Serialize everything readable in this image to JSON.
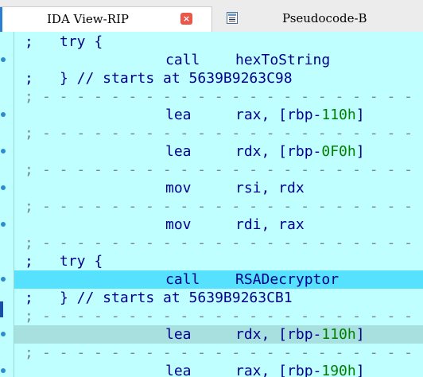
{
  "tabs": [
    {
      "label": "IDA View-RIP",
      "active": true,
      "close_glyph": "×"
    },
    {
      "label": "Pseudocode-B",
      "active": false,
      "icon": "pseudocode-icon"
    }
  ],
  "code": {
    "lines": [
      {
        "kind": "comment",
        "prefix": ";",
        "text": "try {"
      },
      {
        "kind": "instr",
        "mnem": "call",
        "op": "hexToString"
      },
      {
        "kind": "comment",
        "prefix": ";",
        "text": "} // starts at 5639B9263C98"
      },
      {
        "kind": "sep",
        "prefix": ";"
      },
      {
        "kind": "instr",
        "mnem": "lea",
        "op_pre": "rax, [rbp-",
        "num": "110h",
        "op_post": "]"
      },
      {
        "kind": "sep",
        "prefix": ";"
      },
      {
        "kind": "instr",
        "mnem": "lea",
        "op_pre": "rdx, [rbp-",
        "num": "0F0h",
        "op_post": "]"
      },
      {
        "kind": "sep",
        "prefix": ";"
      },
      {
        "kind": "instr",
        "mnem": "mov",
        "op": "rsi, rdx"
      },
      {
        "kind": "sep",
        "prefix": ";"
      },
      {
        "kind": "instr",
        "mnem": "mov",
        "op": "rdi, rax"
      },
      {
        "kind": "sep",
        "prefix": ";"
      },
      {
        "kind": "comment",
        "prefix": ";",
        "text": "try {"
      },
      {
        "kind": "instr",
        "mnem": "call",
        "op": "RSADecryptor",
        "highlight": "current"
      },
      {
        "kind": "comment",
        "prefix": ";",
        "text": "} // starts at 5639B9263CB1"
      },
      {
        "kind": "sep",
        "prefix": ";"
      },
      {
        "kind": "instr",
        "mnem": "lea",
        "op_pre": "rdx, [rbp-",
        "num": "110h",
        "op_post": "]",
        "highlight": "selected"
      },
      {
        "kind": "sep",
        "prefix": ";"
      },
      {
        "kind": "instr",
        "mnem": "lea",
        "op_pre": "rax, [rbp-",
        "num": "190h",
        "op_post": "]"
      }
    ]
  },
  "colors": {
    "background": "#c0ffff",
    "current_line": "#56e1ff",
    "selected_line": "#a8e0e0",
    "numbers": "#008000"
  }
}
